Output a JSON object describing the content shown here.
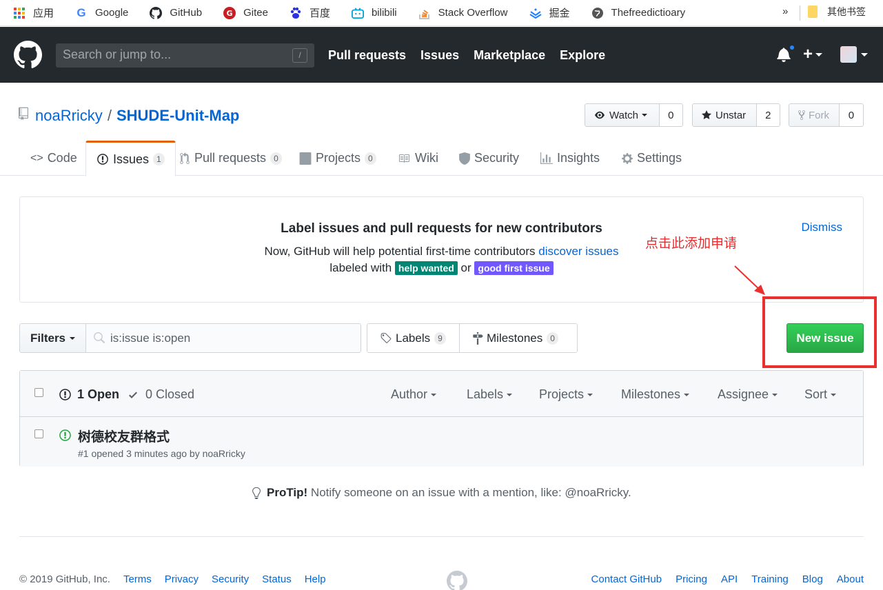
{
  "bookmarks": {
    "items": [
      {
        "label": "应用",
        "icon": "apps-grid-icon"
      },
      {
        "label": "Google",
        "icon": "google-icon"
      },
      {
        "label": "GitHub",
        "icon": "github-icon"
      },
      {
        "label": "Gitee",
        "icon": "gitee-icon"
      },
      {
        "label": "百度",
        "icon": "baidu-icon"
      },
      {
        "label": "bilibili",
        "icon": "bilibili-icon"
      },
      {
        "label": "Stack Overflow",
        "icon": "stackoverflow-icon"
      },
      {
        "label": "掘金",
        "icon": "juejin-icon"
      },
      {
        "label": "Thefreedictioary",
        "icon": "globe-icon"
      }
    ],
    "more": "»",
    "other": "其他书签"
  },
  "header": {
    "search_placeholder": "Search or jump to...",
    "search_shortcut": "/",
    "nav": [
      "Pull requests",
      "Issues",
      "Marketplace",
      "Explore"
    ],
    "plus": "+"
  },
  "repo": {
    "owner": "noaRricky",
    "separator": "/",
    "name": "SHUDE-Unit-Map",
    "watch_label": "Watch",
    "watch_count": "0",
    "star_label": "Unstar",
    "star_count": "2",
    "fork_label": "Fork",
    "fork_count": "0"
  },
  "tabs": [
    {
      "label": "Code",
      "count": ""
    },
    {
      "label": "Issues",
      "count": "1"
    },
    {
      "label": "Pull requests",
      "count": "0"
    },
    {
      "label": "Projects",
      "count": "0"
    },
    {
      "label": "Wiki",
      "count": ""
    },
    {
      "label": "Security",
      "count": ""
    },
    {
      "label": "Insights",
      "count": ""
    },
    {
      "label": "Settings",
      "count": ""
    }
  ],
  "contrib": {
    "heading": "Label issues and pull requests for new contributors",
    "line1_text": "Now, GitHub will help potential first-time contributors ",
    "line1_link": "discover issues",
    "line2_prefix": "labeled with",
    "label_help": "help wanted",
    "line2_or": "or",
    "label_good": "good first issue",
    "dismiss": "Dismiss",
    "colors": {
      "help": "#008672",
      "good": "#7057ff"
    }
  },
  "annotation": "点击此添加申请",
  "filters": {
    "button": "Filters",
    "query": "is:issue is:open",
    "labels_label": "Labels",
    "labels_count": "9",
    "milestones_label": "Milestones",
    "milestones_count": "0",
    "new_issue": "New issue"
  },
  "issues": {
    "open_label": "1 Open",
    "closed_label": "0 Closed",
    "sorts": [
      "Author",
      "Labels",
      "Projects",
      "Milestones",
      "Assignee",
      "Sort"
    ],
    "rows": [
      {
        "title": "树德校友群格式",
        "meta": "#1 opened 3 minutes ago by noaRricky"
      }
    ]
  },
  "protip": {
    "bold": "ProTip!",
    "text": " Notify someone on an issue with a mention, like: @noaRricky."
  },
  "footer": {
    "copyright": "© 2019 GitHub, Inc.",
    "left_links": [
      "Terms",
      "Privacy",
      "Security",
      "Status",
      "Help"
    ],
    "right_links": [
      "Contact GitHub",
      "Pricing",
      "API",
      "Training",
      "Blog",
      "About"
    ]
  }
}
